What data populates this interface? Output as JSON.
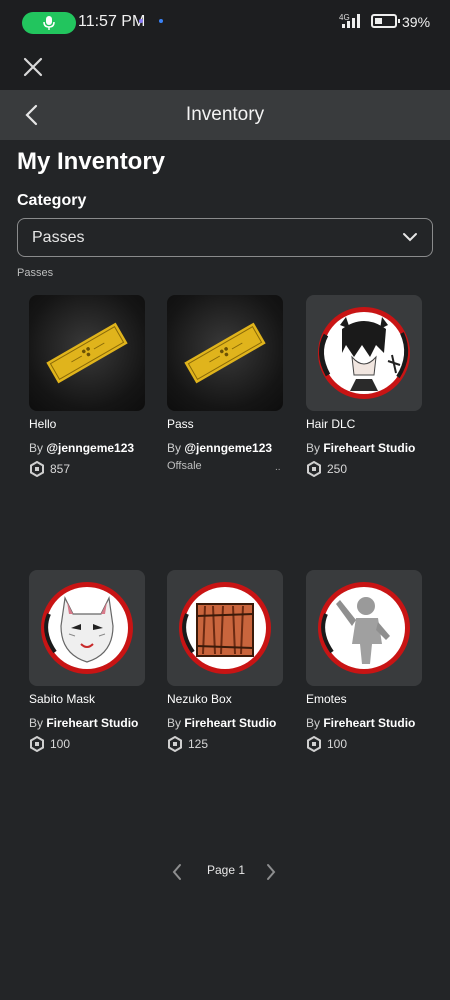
{
  "status_bar": {
    "time": "11:57 PM",
    "network": "4G",
    "battery": "39%",
    "battery_level": 0.39,
    "icons": [
      "mic-icon",
      "signal-icon",
      "battery-icon"
    ]
  },
  "header": {
    "title": "Inventory"
  },
  "page": {
    "title": "My Inventory",
    "category_label": "Category",
    "category_value": "Passes",
    "section_label": "Passes"
  },
  "items": [
    {
      "name": "Hello",
      "by": "By ",
      "creator": "@jenngeme123",
      "price": "857"
    },
    {
      "name": "Pass",
      "by": "By ",
      "creator": "@jenngeme123",
      "status": "Offsale",
      "more": ".."
    },
    {
      "name": "Hair DLC",
      "by": "By ",
      "creator": "Fireheart Studio",
      "price": "250"
    },
    {
      "name": "Sabito Mask",
      "by": "By ",
      "creator": "Fireheart Studio",
      "price": "100"
    },
    {
      "name": "Nezuko Box",
      "by": "By ",
      "creator": "Fireheart Studio",
      "price": "125"
    },
    {
      "name": "Emotes",
      "by": "By ",
      "creator": "Fireheart Studio",
      "price": "100"
    }
  ],
  "pagination": {
    "label": "Page 1"
  },
  "colors": {
    "background": "#232527",
    "header": "#393b3d",
    "accent_green": "#22c55e",
    "pass_gold": "#e0b41c",
    "badge_red": "#d11a1a"
  }
}
